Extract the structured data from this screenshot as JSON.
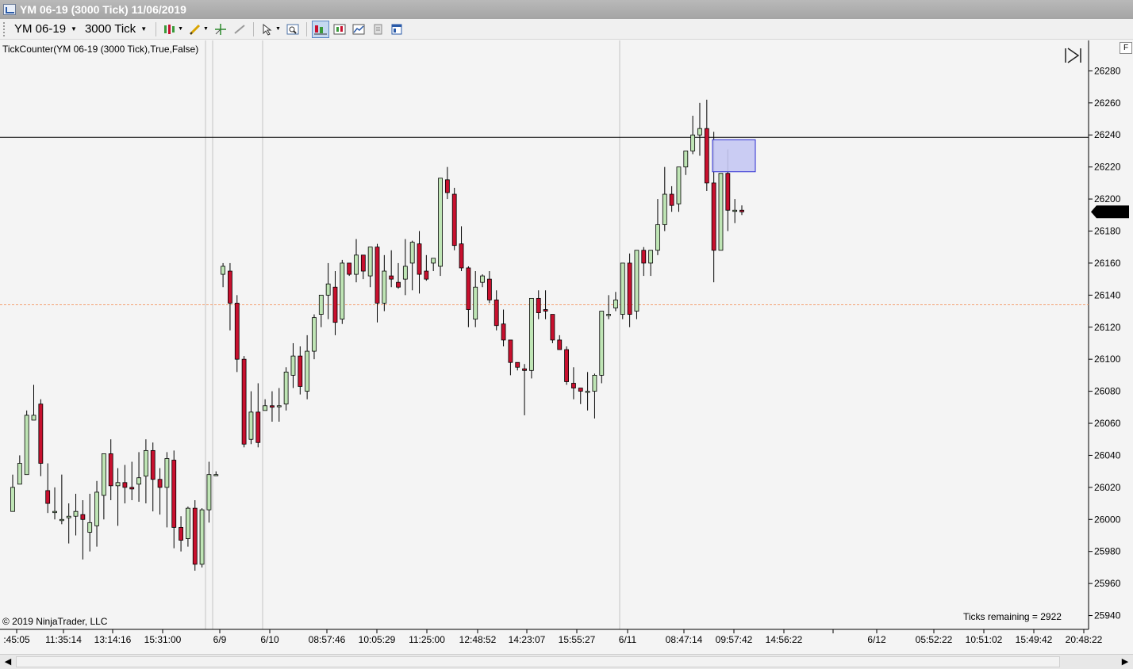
{
  "window": {
    "title": "YM 06-19 (3000 Tick)  11/06/2019"
  },
  "toolbar": {
    "instrument": "YM 06-19",
    "interval": "3000 Tick",
    "icons": [
      "candlestick-style-icon",
      "drawing-tool-icon",
      "crosshair-icon",
      "pointer-icon",
      "zoom-icon",
      "data-series-icon",
      "indicators-icon",
      "strategies-icon",
      "templates-icon",
      "properties-icon"
    ]
  },
  "chart": {
    "indicator_label": "TickCounter(YM 06-19 (3000 Tick),True,False)",
    "copyright": "© 2019 NinjaTrader, LLC",
    "ticks_remaining": "Ticks remaining = 2922",
    "f_button": "F",
    "current_price": "26192",
    "horizontal_lines": [
      26238.5,
      26134
    ],
    "colors": {
      "up": "#bfe5b5",
      "down": "#c8102e",
      "outline": "#000000",
      "hline": "#000000",
      "orange_line": "#f4a070",
      "rect_fill": "#c5c8f3",
      "rect_stroke": "#2b2bd0",
      "price_marker": "#000000"
    }
  },
  "chart_data": {
    "type": "candlestick",
    "instrument": "YM 06-19",
    "y_ticks": [
      26280,
      26260,
      26240,
      26220,
      26200,
      26180,
      26160,
      26140,
      26120,
      26100,
      26080,
      26060,
      26040,
      26020,
      26000,
      25980,
      25960,
      25940
    ],
    "ylim": [
      25933,
      26296
    ],
    "x_ticks": [
      ":45:05",
      "11:35:14",
      "13:14:16",
      "15:31:00",
      "6/9",
      "6/10",
      "08:57:46",
      "10:05:29",
      "11:25:00",
      "12:48:52",
      "14:23:07",
      "15:55:27",
      "6/11",
      "08:47:14",
      "09:57:42",
      "14:56:22",
      "6/12",
      "05:52:22",
      "10:51:02",
      "15:49:42",
      "20:48:22"
    ],
    "candles": [
      [
        26005,
        26028,
        26020,
        26010
      ],
      [
        26022,
        26040,
        26035,
        26028
      ],
      [
        26028,
        26068,
        26065,
        26040
      ],
      [
        26062,
        26084,
        26065,
        26075
      ],
      [
        26072,
        26075,
        26035,
        26027
      ],
      [
        26018,
        26035,
        26010,
        26004
      ],
      [
        26005,
        26020,
        26005,
        26000
      ],
      [
        26000,
        26028,
        26000,
        25997
      ],
      [
        26001,
        26010,
        26002,
        25985
      ],
      [
        26002,
        26016,
        26005,
        25990
      ],
      [
        26003,
        26012,
        26000,
        25975
      ],
      [
        25992,
        26016,
        25998,
        25980
      ],
      [
        25996,
        26024,
        26017,
        25983
      ],
      [
        26015,
        26038,
        26041,
        26000
      ],
      [
        26041,
        26050,
        26021,
        26012
      ],
      [
        26021,
        26032,
        26023,
        25996
      ],
      [
        26023,
        26034,
        26020,
        26010
      ],
      [
        26020,
        26036,
        26019,
        26012
      ],
      [
        26022,
        26042,
        26026,
        26011
      ],
      [
        26027,
        26050,
        26043,
        26010
      ],
      [
        26043,
        26048,
        26025,
        26005
      ],
      [
        26025,
        26032,
        26020,
        26003
      ],
      [
        26020,
        26042,
        26038,
        25995
      ],
      [
        26037,
        26043,
        25995,
        25982
      ],
      [
        25995,
        26002,
        25987,
        25980
      ],
      [
        25988,
        26008,
        26007,
        25983
      ],
      [
        26007,
        26012,
        25972,
        25968
      ],
      [
        25972,
        26007,
        26006,
        25970
      ],
      [
        26006,
        26036,
        26028,
        25998
      ],
      [
        26028,
        26030,
        26028,
        26028
      ],
      [
        26153,
        26160,
        26158,
        26145
      ],
      [
        26155,
        26160,
        26135,
        26118
      ],
      [
        26135,
        26140,
        26100,
        26092
      ],
      [
        26100,
        26102,
        26047,
        26045
      ],
      [
        26050,
        26080,
        26067,
        26047
      ],
      [
        26067,
        26085,
        26048,
        26045
      ],
      [
        26068,
        26075,
        26071,
        26068
      ],
      [
        26071,
        26080,
        26070,
        26061
      ],
      [
        26071,
        26082,
        26071,
        26061
      ],
      [
        26072,
        26095,
        26092,
        26068
      ],
      [
        26090,
        26110,
        26102,
        26082
      ],
      [
        26102,
        26108,
        26083,
        26078
      ],
      [
        26080,
        26115,
        26105,
        26075
      ],
      [
        26105,
        26128,
        26126,
        26100
      ],
      [
        26128,
        26138,
        26140,
        26120
      ],
      [
        26140,
        26160,
        26147,
        26125
      ],
      [
        26145,
        26155,
        26123,
        26115
      ],
      [
        26125,
        26162,
        26160,
        26122
      ],
      [
        26160,
        26160,
        26153,
        26152
      ],
      [
        26153,
        26175,
        26165,
        26148
      ],
      [
        26165,
        26164,
        26155,
        26150
      ],
      [
        26152,
        26170,
        26170,
        26145
      ],
      [
        26170,
        26172,
        26135,
        26123
      ],
      [
        26135,
        26165,
        26155,
        26130
      ],
      [
        26152,
        26168,
        26150,
        26145
      ],
      [
        26148,
        26160,
        26145,
        26144
      ],
      [
        26150,
        26175,
        26158,
        26140
      ],
      [
        26160,
        26174,
        26173,
        26143
      ],
      [
        26172,
        26180,
        26153,
        26141
      ],
      [
        26155,
        26165,
        26150,
        26149
      ],
      [
        26160,
        26162,
        26163,
        26155
      ],
      [
        26158,
        26175,
        26213,
        26152
      ],
      [
        26212,
        26220,
        26204,
        26200
      ],
      [
        26203,
        26207,
        26171,
        26168
      ],
      [
        26172,
        26183,
        26157,
        26155
      ],
      [
        26157,
        26158,
        26131,
        26120
      ],
      [
        26125,
        26155,
        26145,
        26120
      ],
      [
        26148,
        26153,
        26152,
        26145
      ],
      [
        26150,
        26155,
        26137,
        26135
      ],
      [
        26137,
        26143,
        26121,
        26118
      ],
      [
        26122,
        26131,
        26112,
        26108
      ],
      [
        26112,
        26098,
        26098,
        26090
      ],
      [
        26098,
        26096,
        26095,
        26093
      ],
      [
        26094,
        26097,
        26093,
        26065
      ],
      [
        26093,
        26138,
        26138,
        26088
      ],
      [
        26138,
        26143,
        26129,
        26125
      ],
      [
        26131,
        26143,
        26130,
        26125
      ],
      [
        26128,
        26123,
        26112,
        26110
      ],
      [
        26112,
        26115,
        26106,
        26108
      ],
      [
        26106,
        26108,
        26086,
        26084
      ],
      [
        26085,
        26095,
        26082,
        26075
      ],
      [
        26082,
        26082,
        26080,
        26072
      ],
      [
        26080,
        26092,
        26080,
        26068
      ],
      [
        26080,
        26091,
        26090,
        26063
      ],
      [
        26090,
        26108,
        26130,
        26085
      ],
      [
        26128,
        26140,
        26128,
        26125
      ],
      [
        26132,
        26142,
        26137,
        26130
      ],
      [
        26128,
        26144,
        26160,
        26125
      ],
      [
        26160,
        26166,
        26128,
        26120
      ],
      [
        26130,
        26165,
        26168,
        26125
      ],
      [
        26168,
        26170,
        26160,
        26152
      ],
      [
        26160,
        26160,
        26168,
        26152
      ],
      [
        26168,
        26200,
        26184,
        26165
      ],
      [
        26184,
        26220,
        26203,
        26180
      ],
      [
        26203,
        26208,
        26196,
        26192
      ],
      [
        26197,
        26214,
        26220,
        26192
      ],
      [
        26220,
        26224,
        26230,
        26215
      ],
      [
        26230,
        26252,
        26240,
        26228
      ],
      [
        26240,
        26260,
        26244,
        26227
      ],
      [
        26244,
        26262,
        26210,
        26205
      ],
      [
        26210,
        26242,
        26168,
        26148
      ],
      [
        26168,
        26195,
        26216,
        26170
      ],
      [
        26216,
        26231,
        26193,
        26180
      ],
      [
        26193,
        26200,
        26193,
        26185
      ],
      [
        26193,
        26196,
        26192,
        26190
      ]
    ],
    "grid": false,
    "drawn_rectangle": {
      "top": 26237,
      "bottom": 26217
    }
  }
}
